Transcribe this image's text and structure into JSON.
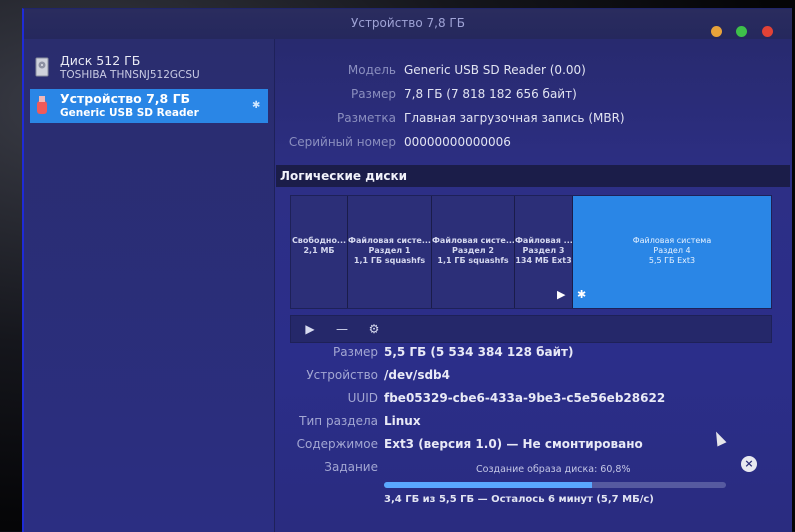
{
  "window": {
    "title": "Устройство 7,8 ГБ"
  },
  "sidebar": {
    "drives": [
      {
        "name": "Диск 512 ГБ",
        "model": "TOSHIBA THNSNJ512GCSU",
        "icon": "hard-disk-icon",
        "selected": false
      },
      {
        "name": "Устройство 7,8 ГБ",
        "model": "Generic USB  SD Reader",
        "icon": "usb-card-reader-icon",
        "selected": true
      }
    ]
  },
  "device": {
    "model_label": "Модель",
    "model": "Generic USB  SD Reader (0.00)",
    "size_label": "Размер",
    "size": "7,8 ГБ (7 818 182 656 байт)",
    "partitioning_label": "Разметка",
    "partitioning": "Главная загрузочная запись (MBR)",
    "serial_label": "Серийный номер",
    "serial": "00000000000006"
  },
  "volumes": {
    "title": "Логические диски",
    "segments": [
      {
        "line1": "Свободно...",
        "line2": "2,1 МБ",
        "line3": "",
        "selected": false
      },
      {
        "line1": "Файловая систе...",
        "line2": "Раздел 1",
        "line3": "1,1 ГБ squashfs",
        "selected": false
      },
      {
        "line1": "Файловая систе...",
        "line2": "Раздел 2",
        "line3": "1,1 ГБ squashfs",
        "selected": false
      },
      {
        "line1": "Файловая ...",
        "line2": "Раздел 3",
        "line3": "134 МБ Ext3",
        "selected": false
      },
      {
        "line1": "Файловая система",
        "line2": "Раздел 4",
        "line3": "5,5 ГБ Ext3",
        "selected": true
      }
    ],
    "toolbar": {
      "mount_icon": "play-icon",
      "remove_icon": "minus-icon",
      "settings_icon": "gears-icon"
    }
  },
  "details": {
    "size_label": "Размер",
    "size": "5,5 ГБ (5 534 384 128 байт)",
    "device_label": "Устройство",
    "device": "/dev/sdb4",
    "uuid_label": "UUID",
    "uuid": "fbe05329-cbe6-433a-9be3-c5e56eb28622",
    "type_label": "Тип раздела",
    "type": "Linux",
    "contents_label": "Содержимое",
    "contents": "Ext3 (версия 1.0) — Не смонтировано",
    "job_label": "Задание",
    "job_text": "Создание образа диска: 60,8%",
    "job_progress": 0.608,
    "job_sub": "3,4 ГБ из 5,5 ГБ — Осталось 6 минут (5,7 МБ/с)"
  }
}
